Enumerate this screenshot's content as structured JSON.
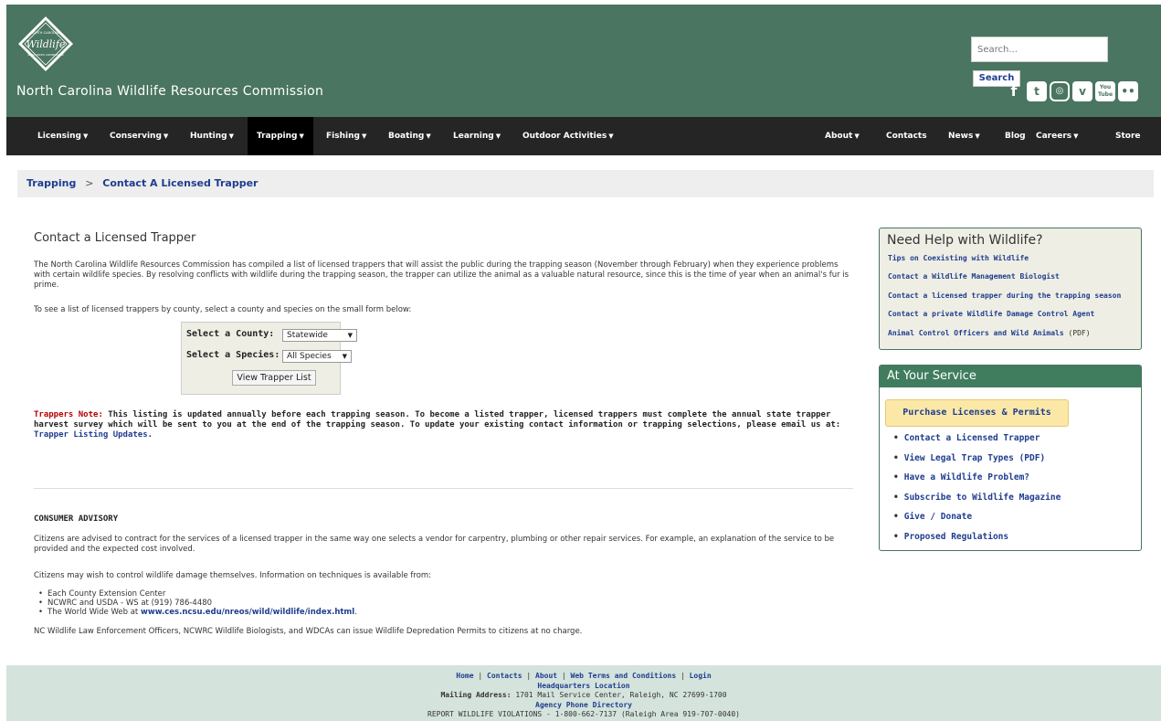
{
  "header": {
    "logo_text": [
      "NORTH CAROLINA",
      "Wildlife",
      "RESOURCES COMMISSION"
    ],
    "site_title": "North Carolina Wildlife Resources Commission",
    "search_placeholder": "Search...",
    "search_button": "Search",
    "social_icons": [
      "facebook-icon",
      "twitter-icon",
      "instagram-icon",
      "vimeo-icon",
      "youtube-icon",
      "flickr-icon"
    ],
    "youtube_label": "You Tube",
    "vimeo_label": "v",
    "twitter_label": "t",
    "facebook_label": "f",
    "instagram_label": "◎",
    "flickr_label": "••"
  },
  "nav": {
    "left": [
      "Licensing",
      "Conserving",
      "Hunting",
      "Trapping",
      "Fishing",
      "Boating",
      "Learning",
      "Outdoor Activities"
    ],
    "right": [
      "About",
      "Contacts",
      "News",
      "Blog",
      "Careers",
      "Store"
    ],
    "active": "Trapping"
  },
  "breadcrumb": {
    "parent": "Trapping",
    "separator": ">",
    "current": "Contact A Licensed Trapper"
  },
  "main": {
    "title": "Contact a Licensed Trapper",
    "intro": "The North Carolina Wildlife Resources Commission has compiled a list of licensed trappers that will assist the public during the trapping season (November through February) when they experience problems with certain wildlife species. By resolving conflicts with wildlife during the trapping season, the trapper can utilize the animal as a valuable natural resource, since this is the time of year when an animal's fur is prime.",
    "instructions": "To see a list of licensed trappers by county, select a county and species on the small form below:",
    "form": {
      "county_label": "Select a County:",
      "county_value": "Statewide",
      "species_label": "Select a Species:",
      "species_value": "All Species",
      "button": "View Trapper List"
    },
    "note_label": "Trappers Note:",
    "note_text": " This listing is updated annually before each trapping season.  To become a listed trapper, licensed trappers must complete the annual state trapper harvest survey which will be sent to you at the end of the trapping season.  To update your existing contact information or trapping selections, please email us at: ",
    "note_link": "Trapper Listing Updates",
    "note_end": ".",
    "advisory_title": "CONSUMER ADVISORY",
    "advisory_p1": "Citizens are advised to contract for the services of a licensed trapper in the same way one selects a vendor for carpentry, plumbing or other repair services. For example, an explanation of the service to be provided and the expected cost involved.",
    "advisory_p2": "Citizens may wish to control wildlife damage themselves. Information on techniques is available from:",
    "advisory_list": {
      "item1": "Each County Extension Center",
      "item2": "NCWRC and USDA - WS at (919) 786-4480",
      "item3_prefix": "The World Wide Web at ",
      "item3_link": "www.ces.ncsu.edu/nreos/wild/wildlife/index.html",
      "item3_suffix": "."
    },
    "advisory_final": "NC Wildlife Law Enforcement Officers, NCWRC Wildlife Biologists, and WDCAs can issue Wildlife Depredation Permits to citizens at no charge."
  },
  "sidebar": {
    "help_title": "Need Help with Wildlife?",
    "help_links": {
      "l1": "Tips on Coexisting with Wildlife",
      "l2": "Contact a Wildlife Management Biologist",
      "l3": "Contact a licensed trapper during the trapping season",
      "l4": "Contact a private Wildlife Damage Control Agent",
      "l5": "Animal Control Officers and Wild Animals",
      "l5_suffix": " (PDF)"
    },
    "service_title": "At Your Service",
    "purchase_button": "Purchase Licenses & Permits",
    "service_links": {
      "s1": "Contact a Licensed Trapper",
      "s2": "View Legal Trap Types (PDF)",
      "s3": "Have a Wildlife Problem?",
      "s4": "Subscribe to Wildlife Magazine",
      "s5": "Give / Donate",
      "s6": "Proposed Regulations"
    }
  },
  "footer": {
    "home": "Home",
    "contacts": "Contacts",
    "about": "About",
    "terms": "Web Terms and Conditions",
    "login": "Login",
    "sep": " | ",
    "hq": "Headquarters Location",
    "mailing_label": "Mailing Address:",
    "mailing_value": " 1701 Mail Service Center, Raleigh, NC 27699-1700",
    "phone_dir": "Agency Phone Directory",
    "report": "REPORT WILDLIFE VIOLATIONS - 1-800-662-7137 (Raleigh Area 919-707-0040)"
  }
}
